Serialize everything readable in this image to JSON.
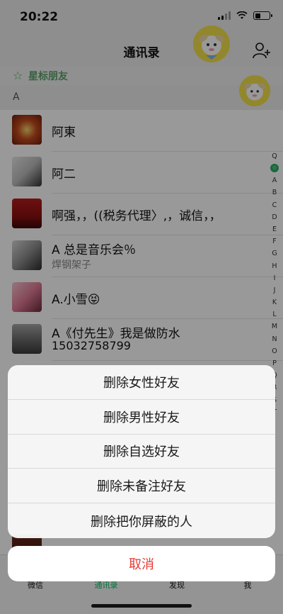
{
  "status_bar": {
    "time": "20:22"
  },
  "nav": {
    "title": "通讯录"
  },
  "star_row": {
    "label": "星标朋友"
  },
  "section": {
    "letter": "A"
  },
  "contacts": [
    {
      "name": "阿東",
      "sub": ""
    },
    {
      "name": "阿二",
      "sub": ""
    },
    {
      "name": "啊强，，((税务代理〉,，诚信，，",
      "sub": ""
    },
    {
      "name": "A 总是音乐会％",
      "sub": "焊钢架子"
    },
    {
      "name": "A.小雪😝",
      "sub": ""
    },
    {
      "name": "A《付先生》我是做防水",
      "sub": "15032758799"
    }
  ],
  "index_bar": [
    "Q",
    "☆",
    "A",
    "B",
    "C",
    "D",
    "E",
    "F",
    "G",
    "H",
    "I",
    "J",
    "K",
    "L",
    "M",
    "N",
    "O",
    "P",
    "Q",
    "R",
    "S",
    "T"
  ],
  "tabs": [
    "微信",
    "通讯录",
    "发现",
    "我"
  ],
  "action_sheet": {
    "items": [
      "删除女性好友",
      "删除男性好友",
      "删除自选好友",
      "删除未备注好友",
      "删除把你屏蔽的人"
    ],
    "cancel": "取消"
  },
  "colors": {
    "accent": "#07c160",
    "cancel": "#e53935",
    "star": "#4caf50"
  }
}
